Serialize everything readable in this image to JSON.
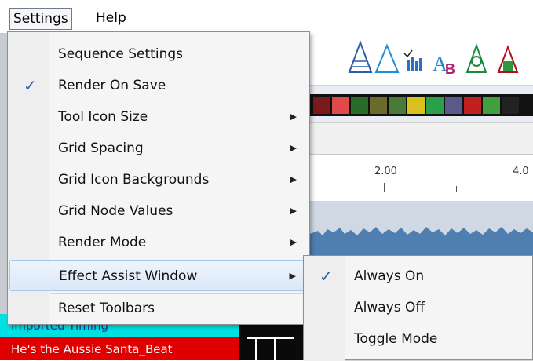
{
  "menubar": {
    "settings": "Settings",
    "help": "Help"
  },
  "settings_menu": {
    "items": [
      {
        "label": "Sequence Settings",
        "checked": false,
        "submenu": false
      },
      {
        "label": "Render On Save",
        "checked": true,
        "submenu": false
      },
      {
        "label": "Tool Icon Size",
        "checked": false,
        "submenu": true
      },
      {
        "label": "Grid Spacing",
        "checked": false,
        "submenu": true
      },
      {
        "label": "Grid Icon Backgrounds",
        "checked": false,
        "submenu": true
      },
      {
        "label": "Grid Node Values",
        "checked": false,
        "submenu": true
      },
      {
        "label": "Render Mode",
        "checked": false,
        "submenu": true
      },
      {
        "label": "Effect Assist Window",
        "checked": false,
        "submenu": true,
        "highlighted": true
      },
      {
        "label": "Reset Toolbars",
        "checked": false,
        "submenu": false
      }
    ]
  },
  "effect_assist_submenu": {
    "items": [
      {
        "label": "Always On",
        "checked": true
      },
      {
        "label": "Always Off",
        "checked": false
      },
      {
        "label": "Toggle Mode",
        "checked": false
      }
    ]
  },
  "ruler": {
    "ticks": [
      "2.00",
      "4.0"
    ]
  },
  "timing_rows": [
    {
      "label": "Imported Timing"
    },
    {
      "label": "He's the Aussie Santa_Beat"
    }
  ],
  "glyphs": {
    "check": "✓",
    "arrow": "▶"
  },
  "colors": {
    "accent": "#1e5fa8",
    "timing_cyan": "#00e0e0",
    "timing_red": "#e10000"
  }
}
